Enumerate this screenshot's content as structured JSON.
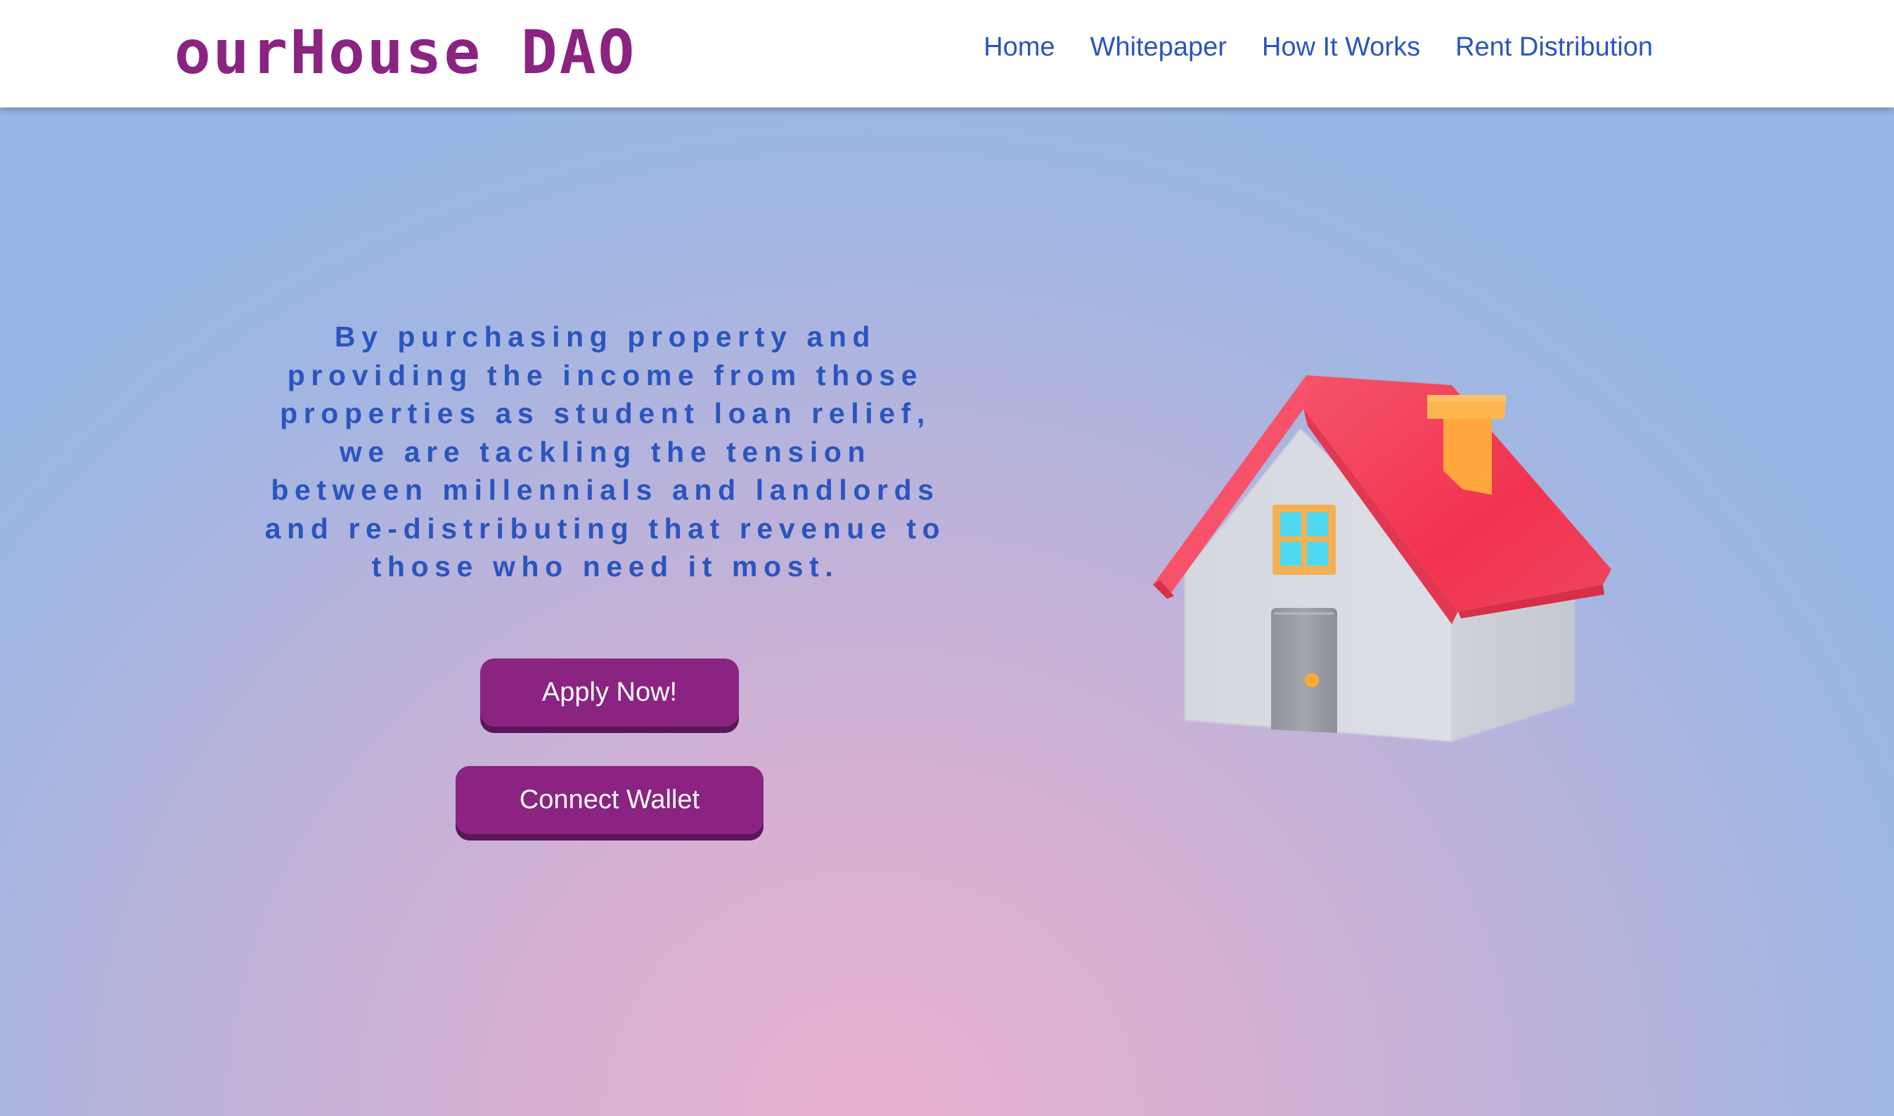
{
  "navbar": {
    "brand": "ourHouse DAO",
    "links": [
      {
        "label": "Home"
      },
      {
        "label": "Whitepaper"
      },
      {
        "label": "How It Works"
      },
      {
        "label": "Rent Distribution"
      }
    ]
  },
  "hero": {
    "description": "By purchasing property and providing the income from those properties as student loan relief, we are tackling the tension between millennials and landlords and re-distributing that revenue to those who need it most.",
    "apply_button": "Apply Now!",
    "connect_button": "Connect Wallet",
    "illustration": "house-icon"
  },
  "colors": {
    "brand": "#8a2381",
    "link": "#2a55bf",
    "button": "#8a2381",
    "button_shadow": "#5c1557",
    "roof": "#f24561",
    "chimney": "#ffa63d",
    "wall": "#d9dbe3",
    "window_glass": "#4fd8f2",
    "door": "#9a9da4"
  }
}
